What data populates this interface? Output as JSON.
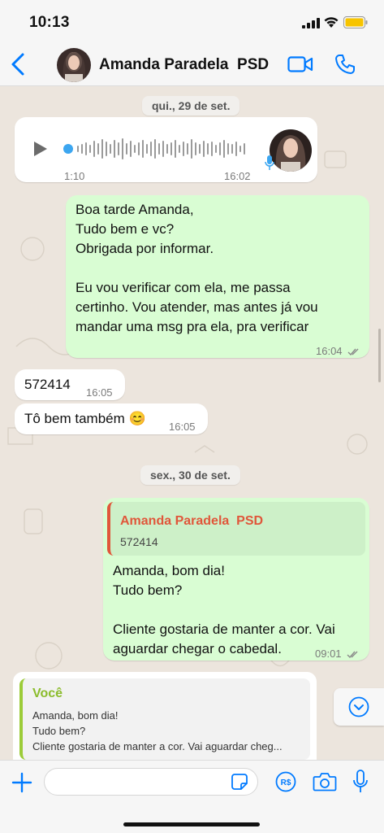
{
  "status_bar": {
    "time": "10:13"
  },
  "header": {
    "contact_name": "Amanda Paradela  PSD"
  },
  "chat": {
    "date_1": "qui., 29 de set.",
    "voice_message": {
      "duration": "1:10",
      "time": "16:02"
    },
    "out_msg_1": {
      "text": "Boa tarde Amanda,\nTudo bem e vc?\nObrigada por informar.\n\nEu vou verificar com ela, me passa\ncertinho. Vou atender, mas antes já vou\nmandar uma msg pra ela, pra verificar",
      "time": "16:04"
    },
    "in_msg_1": {
      "text": "572414",
      "time": "16:05"
    },
    "in_msg_2": {
      "text": "Tô bem também 😊",
      "time": "16:05"
    },
    "date_2": "sex., 30 de set.",
    "out_msg_2": {
      "quoted_author": "Amanda Paradela  PSD",
      "quoted_text": "572414",
      "text": "Amanda, bom dia!\nTudo bem?\n\nCliente gostaria de manter a cor. Vai\naguardar chegar o cabedal.",
      "time": "09:01"
    }
  },
  "reply_preview": {
    "author": "Você",
    "line_1": "Amanda, bom dia!",
    "line_2": "Tudo bem?",
    "line_3": "Cliente gostaria de manter a cor. Vai aguardar cheg..."
  },
  "composer": {
    "placeholder": ""
  },
  "colors": {
    "accent": "#007aff",
    "outgoing": "#d9fdd3",
    "quote_author": "#e0563a",
    "reply_author": "#8bbc2c"
  }
}
